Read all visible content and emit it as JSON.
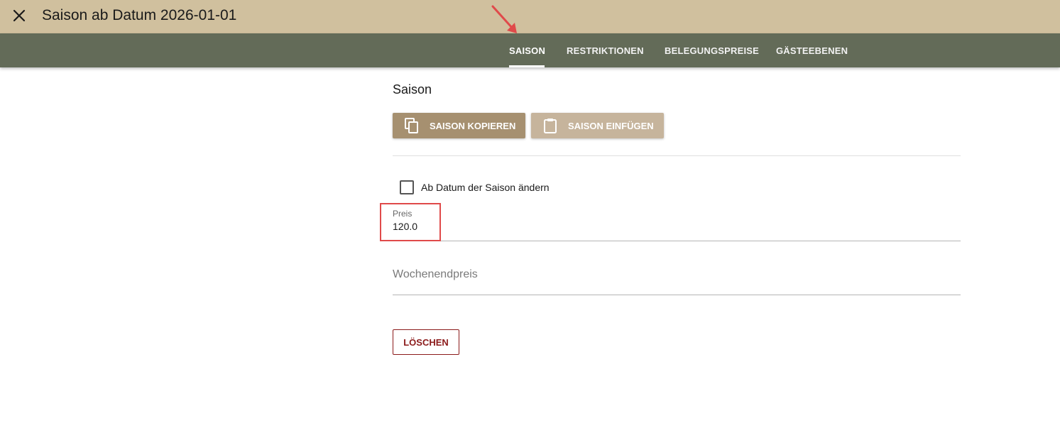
{
  "header": {
    "title": "Saison ab Datum 2026-01-01",
    "close_icon": "close-icon"
  },
  "tabs": [
    {
      "label": "SAISON",
      "active": true
    },
    {
      "label": "RESTRIKTIONEN",
      "active": false
    },
    {
      "label": "BELEGUNGSPREISE",
      "active": false
    },
    {
      "label": "GÄSTEEBENEN",
      "active": false
    }
  ],
  "section": {
    "title": "Saison",
    "copy_button": "SAISON KOPIEREN",
    "copy_icon": "copy-icon",
    "paste_button": "SAISON EINFÜGEN",
    "paste_icon": "clipboard-icon"
  },
  "form": {
    "checkbox_label": "Ab Datum der Saison ändern",
    "checkbox_checked": false,
    "price_label": "Preis",
    "price_value": "120.0",
    "weekend_price_placeholder": "Wochenendpreis"
  },
  "actions": {
    "delete_button": "LÖSCHEN"
  },
  "colors": {
    "titlebar": "#d0c09e",
    "tabbar": "#636b58",
    "copy_button": "#a69070",
    "paste_button": "#c6b49c",
    "delete": "#8b1a1a",
    "annotation": "#e04a4a"
  }
}
